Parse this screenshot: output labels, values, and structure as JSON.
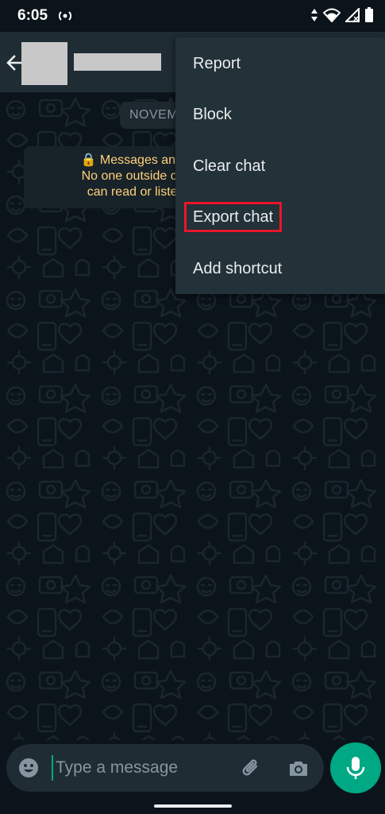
{
  "status_bar": {
    "time": "6:05",
    "icons": [
      "cast-icon",
      "data-arrows-icon",
      "wifi-icon",
      "signal-icon",
      "battery-icon"
    ]
  },
  "header": {
    "back_icon": "arrow-left-icon",
    "avatar": "redacted",
    "name": "redacted"
  },
  "chat": {
    "date_chip": "NOVEM",
    "encryption_lines": [
      "🔒 Messages and call",
      "No one outside of this",
      "can read or listen to"
    ]
  },
  "menu": {
    "items": [
      {
        "label": "Report"
      },
      {
        "label": "Block"
      },
      {
        "label": "Clear chat"
      },
      {
        "label": "Export chat",
        "highlighted": true
      },
      {
        "label": "Add shortcut"
      }
    ]
  },
  "input_bar": {
    "placeholder": "Type a message",
    "value": "",
    "emoji_icon": "emoji-icon",
    "attach_icon": "paperclip-icon",
    "camera_icon": "camera-icon"
  },
  "mic": {
    "icon": "microphone-icon"
  },
  "colors": {
    "background": "#0b141a",
    "header": "#1f2c34",
    "menu": "#233138",
    "accent": "#00a884",
    "highlight_border": "#e8162a",
    "encryption_text": "#ffd279"
  }
}
